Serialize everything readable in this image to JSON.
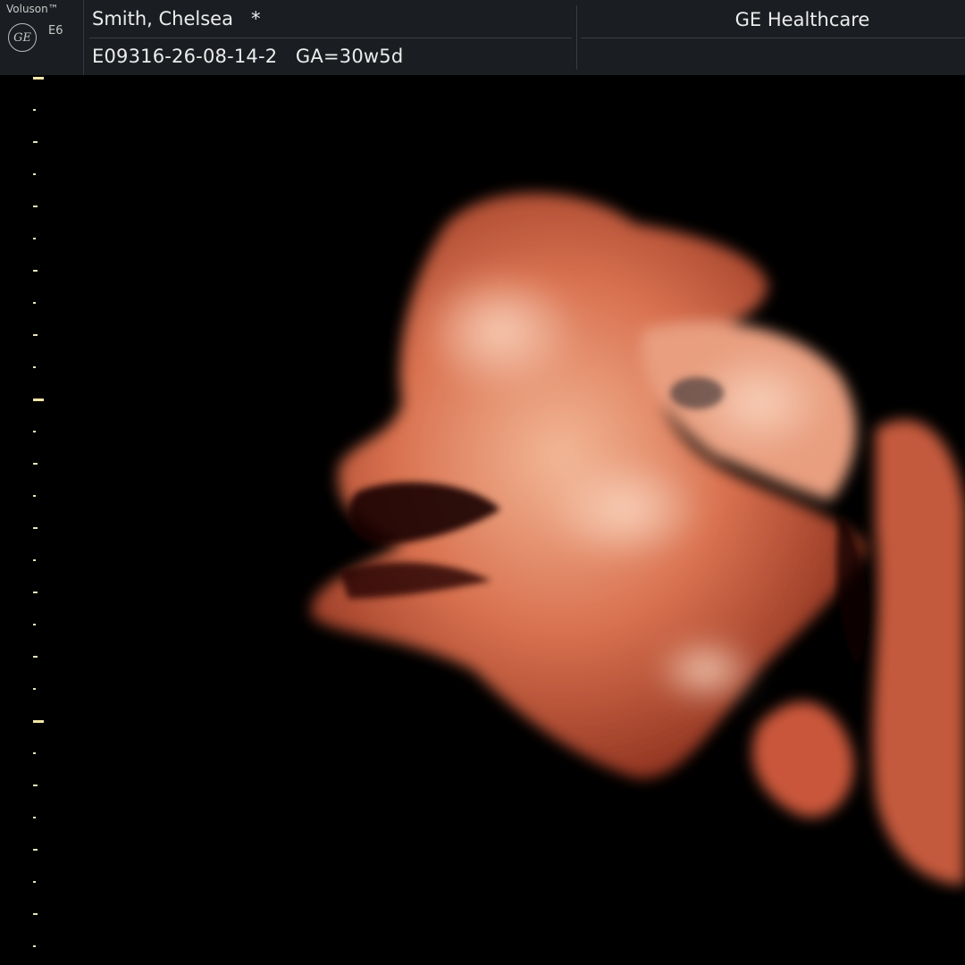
{
  "header": {
    "brand": "Voluson™",
    "logo_text": "GE",
    "model": "E6",
    "patient_name": "Smith, Chelsea   *",
    "patient_id_ga": "E09316-26-08-14-2   GA=30w5d",
    "vendor": "GE Healthcare"
  },
  "colors": {
    "background": "#000000",
    "header_bg": "#1a1d21",
    "ruler_tick": "#e8e3b8",
    "render_skin": "#d9714f"
  },
  "image": {
    "type": "3D/4D ultrasound surface render",
    "icon": "fetal-face-render"
  }
}
